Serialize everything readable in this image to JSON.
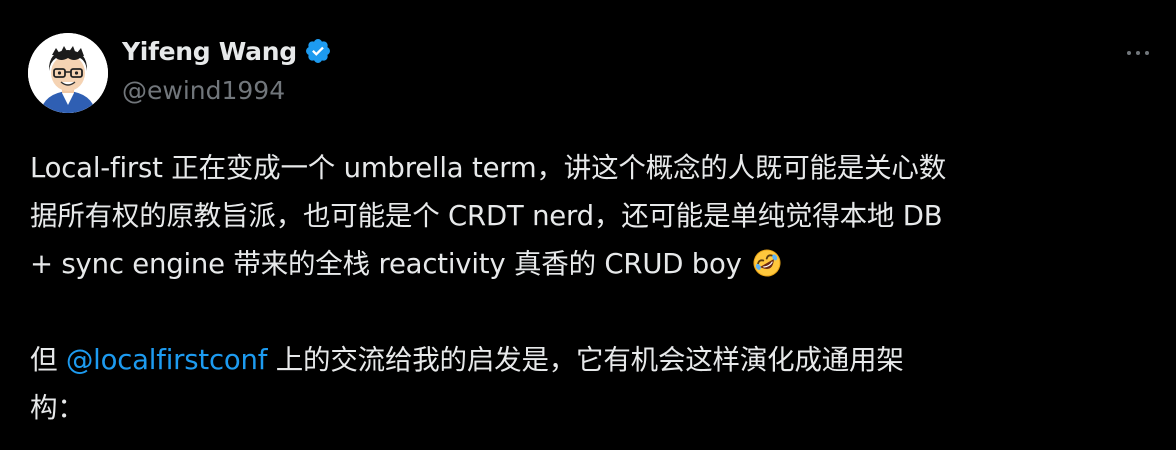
{
  "author": {
    "display_name": "Yifeng Wang",
    "handle": "@ewind1994",
    "verified_icon": "verified-badge-icon",
    "avatar": "avatar-cartoon"
  },
  "more_icon": "more-horizontal-icon",
  "text": {
    "line1": "Local-first 正在变成一个 umbrella term，讲这个概念的人既可能是关心数",
    "line2": "据所有权的原教旨派，也可能是个 CRDT nerd，还可能是单纯觉得本地 DB",
    "line3": "+ sync engine 带来的全栈 reactivity 真香的 CRUD boy",
    "emoji": "rolling-on-floor-laughing-emoji",
    "p2_prefix": "但 ",
    "mention": "@localfirstconf",
    "p2_rest_line1": " 上的交流给我的启发是，它有机会这样演化成通用架",
    "p2_line2": "构："
  },
  "colors": {
    "background": "#000000",
    "text": "#e7e9ea",
    "secondary": "#71767b",
    "link": "#1d9bf0"
  }
}
